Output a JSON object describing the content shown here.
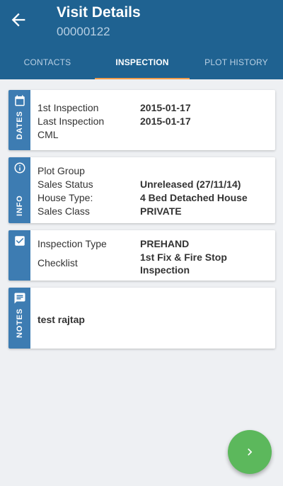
{
  "header": {
    "title": "Visit Details",
    "subtitle": "00000122"
  },
  "tabs": [
    {
      "label": "CONTACTS",
      "active": false
    },
    {
      "label": "INSPECTION",
      "active": true
    },
    {
      "label": "PLOT HISTORY",
      "active": false
    }
  ],
  "colors": {
    "appbar": "#1f6291",
    "accent": "#f39c4b",
    "strip": "#3d7cb2",
    "fab": "#5cb85c"
  },
  "cards": {
    "dates": {
      "label": "DATES",
      "icon": "calendar-icon",
      "rows": [
        {
          "label": "1st Inspection",
          "value": "2015-01-17"
        },
        {
          "label": "Last Inspection",
          "value": "2015-01-17"
        },
        {
          "label": "CML",
          "value": ""
        }
      ]
    },
    "info": {
      "label": "INFO",
      "icon": "info-icon",
      "rows": [
        {
          "label": "Plot Group",
          "value": ""
        },
        {
          "label": "Sales Status",
          "value": "Unreleased (27/11/14)"
        },
        {
          "label": "House Type:",
          "value": "4 Bed Detached House"
        },
        {
          "label": "Sales Class",
          "value": "PRIVATE"
        }
      ]
    },
    "inspection": {
      "icon": "checkbox-icon",
      "rows": [
        {
          "label": "Inspection Type",
          "value": "PREHAND"
        },
        {
          "label": "Checklist",
          "value": "1st Fix & Fire Stop Inspection"
        }
      ]
    },
    "notes": {
      "label": "NOTES",
      "icon": "comment-icon",
      "text": "test rajtap"
    }
  },
  "fab": {
    "icon": "chevron-right-icon"
  }
}
